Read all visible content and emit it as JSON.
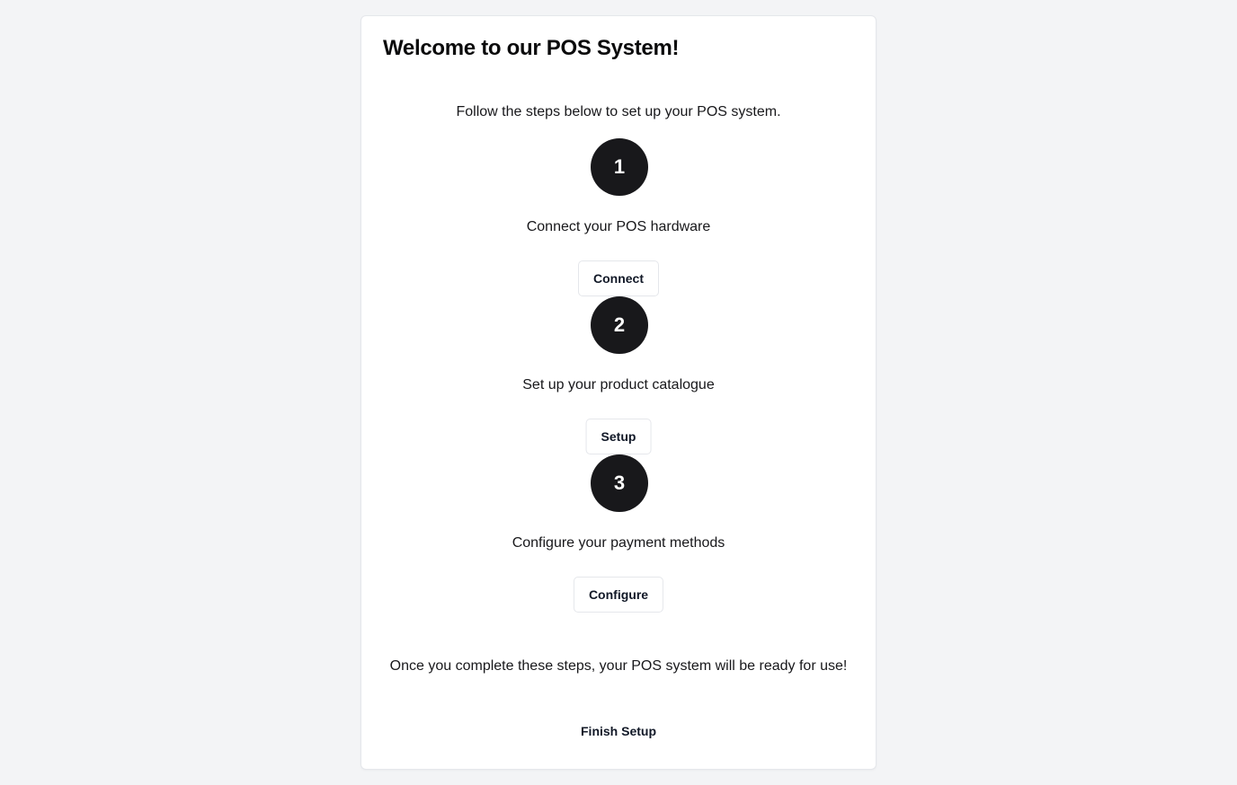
{
  "card": {
    "title": "Welcome to our POS System!",
    "intro": "Follow the steps below to set up your POS system.",
    "steps": [
      {
        "number": "1",
        "text": "Connect your POS hardware",
        "button_label": "Connect"
      },
      {
        "number": "2",
        "text": "Set up your product catalogue",
        "button_label": "Setup"
      },
      {
        "number": "3",
        "text": "Configure your payment methods",
        "button_label": "Configure"
      }
    ],
    "outro": "Once you complete these steps, your POS system will be ready for use!",
    "finish_label": "Finish Setup"
  },
  "colors": {
    "background": "#f3f4f6",
    "card": "#ffffff",
    "circle": "#18181b",
    "border": "#e5e7eb"
  }
}
